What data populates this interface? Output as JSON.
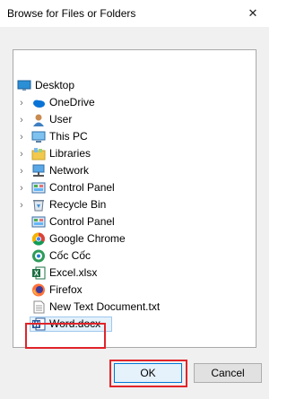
{
  "window": {
    "title": "Browse for Files or Folders",
    "close_glyph": "✕"
  },
  "tree": {
    "items": [
      {
        "label": "Desktop",
        "icon": "desktop-icon",
        "expandable": false,
        "level": 0
      },
      {
        "label": "OneDrive",
        "icon": "onedrive-cloud-icon",
        "expandable": true,
        "level": 1
      },
      {
        "label": "User",
        "icon": "user-icon",
        "expandable": true,
        "level": 1
      },
      {
        "label": "This PC",
        "icon": "computer-icon",
        "expandable": true,
        "level": 1
      },
      {
        "label": "Libraries",
        "icon": "libraries-icon",
        "expandable": true,
        "level": 1
      },
      {
        "label": "Network",
        "icon": "network-icon",
        "expandable": true,
        "level": 1
      },
      {
        "label": "Control Panel",
        "icon": "control-panel-icon",
        "expandable": true,
        "level": 1
      },
      {
        "label": "Recycle Bin",
        "icon": "recycle-bin-icon",
        "expandable": true,
        "level": 1
      },
      {
        "label": "Control Panel",
        "icon": "control-panel-icon",
        "expandable": false,
        "level": 1
      },
      {
        "label": "Google Chrome",
        "icon": "chrome-icon",
        "expandable": false,
        "level": 1
      },
      {
        "label": "Cốc Cốc",
        "icon": "coccoc-icon",
        "expandable": false,
        "level": 1
      },
      {
        "label": "Excel.xlsx",
        "icon": "excel-file-icon",
        "expandable": false,
        "level": 1
      },
      {
        "label": "Firefox",
        "icon": "firefox-icon",
        "expandable": false,
        "level": 1
      },
      {
        "label": "New Text Document.txt",
        "icon": "text-file-icon",
        "expandable": false,
        "level": 1
      },
      {
        "label": "Word.docx",
        "icon": "word-file-icon",
        "expandable": false,
        "level": 1,
        "selected": true
      }
    ]
  },
  "buttons": {
    "ok": "OK",
    "cancel": "Cancel"
  },
  "colors": {
    "highlight_red": "#e1242a",
    "selection_bg": "#e5f1fb",
    "dialog_bg": "#f0f0f0"
  }
}
